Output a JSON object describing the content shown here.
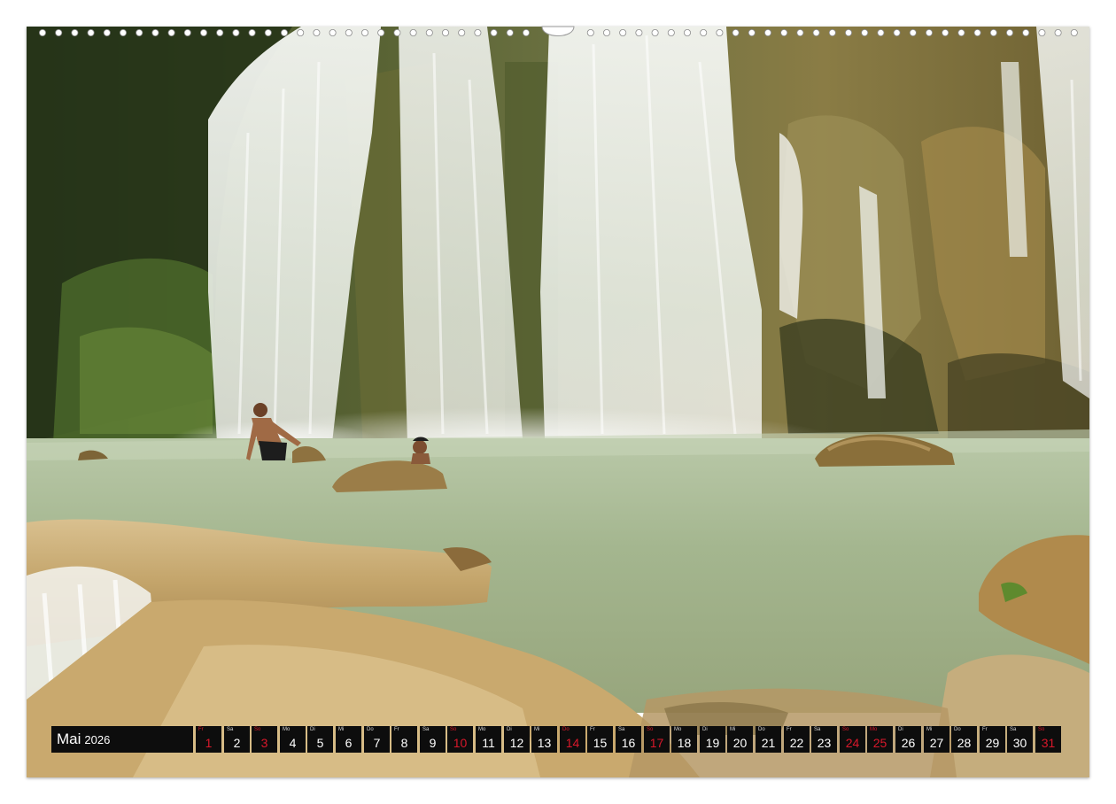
{
  "calendar": {
    "month": "Mai",
    "year": "2026",
    "days": [
      {
        "weekday": "Fr",
        "day": "1",
        "red": true
      },
      {
        "weekday": "Sa",
        "day": "2",
        "red": false
      },
      {
        "weekday": "So",
        "day": "3",
        "red": true
      },
      {
        "weekday": "Mo",
        "day": "4",
        "red": false
      },
      {
        "weekday": "Di",
        "day": "5",
        "red": false
      },
      {
        "weekday": "Mi",
        "day": "6",
        "red": false
      },
      {
        "weekday": "Do",
        "day": "7",
        "red": false
      },
      {
        "weekday": "Fr",
        "day": "8",
        "red": false
      },
      {
        "weekday": "Sa",
        "day": "9",
        "red": false
      },
      {
        "weekday": "So",
        "day": "10",
        "red": true
      },
      {
        "weekday": "Mo",
        "day": "11",
        "red": false
      },
      {
        "weekday": "Di",
        "day": "12",
        "red": false
      },
      {
        "weekday": "Mi",
        "day": "13",
        "red": false
      },
      {
        "weekday": "Do",
        "day": "14",
        "red": true
      },
      {
        "weekday": "Fr",
        "day": "15",
        "red": false
      },
      {
        "weekday": "Sa",
        "day": "16",
        "red": false
      },
      {
        "weekday": "So",
        "day": "17",
        "red": true
      },
      {
        "weekday": "Mo",
        "day": "18",
        "red": false
      },
      {
        "weekday": "Di",
        "day": "19",
        "red": false
      },
      {
        "weekday": "Mi",
        "day": "20",
        "red": false
      },
      {
        "weekday": "Do",
        "day": "21",
        "red": false
      },
      {
        "weekday": "Fr",
        "day": "22",
        "red": false
      },
      {
        "weekday": "Sa",
        "day": "23",
        "red": false
      },
      {
        "weekday": "So",
        "day": "24",
        "red": true
      },
      {
        "weekday": "Mo",
        "day": "25",
        "red": true
      },
      {
        "weekday": "Di",
        "day": "26",
        "red": false
      },
      {
        "weekday": "Mi",
        "day": "27",
        "red": false
      },
      {
        "weekday": "Do",
        "day": "28",
        "red": false
      },
      {
        "weekday": "Fr",
        "day": "29",
        "red": false
      },
      {
        "weekday": "Sa",
        "day": "30",
        "red": false
      },
      {
        "weekday": "So",
        "day": "31",
        "red": true
      }
    ]
  },
  "colors": {
    "calendar_bg": "#0d0d0d",
    "holiday_red": "#d9182b",
    "pool_water": "#9fb592",
    "rock": "#b8935a"
  }
}
